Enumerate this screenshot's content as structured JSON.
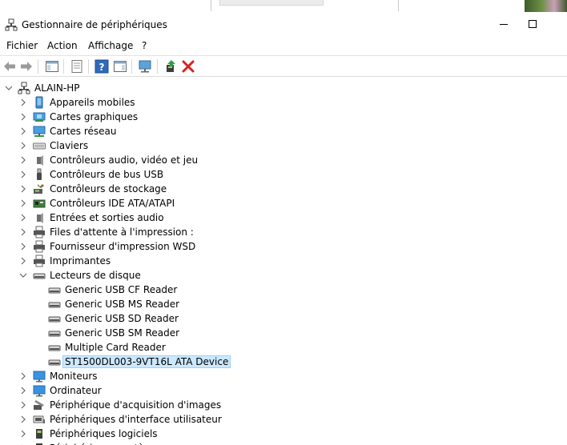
{
  "window": {
    "title": "Gestionnaire de périphériques"
  },
  "menu": {
    "items": [
      "Fichier",
      "Action",
      "Affichage",
      "?"
    ]
  },
  "tree": {
    "root": "ALAIN-HP",
    "categories": [
      {
        "label": "Appareils mobiles",
        "icon": "mobile-device-icon",
        "expanded": false
      },
      {
        "label": "Cartes graphiques",
        "icon": "display-adapter-icon",
        "expanded": false
      },
      {
        "label": "Cartes réseau",
        "icon": "network-adapter-icon",
        "expanded": false
      },
      {
        "label": "Claviers",
        "icon": "keyboard-icon",
        "expanded": false
      },
      {
        "label": "Contrôleurs audio, vidéo et jeu",
        "icon": "speaker-icon",
        "expanded": false
      },
      {
        "label": "Contrôleurs de bus USB",
        "icon": "usb-icon",
        "expanded": false
      },
      {
        "label": "Contrôleurs de stockage",
        "icon": "storage-controller-icon",
        "expanded": false
      },
      {
        "label": "Contrôleurs IDE ATA/ATAPI",
        "icon": "ide-controller-icon",
        "expanded": false
      },
      {
        "label": "Entrées et sorties audio",
        "icon": "speaker-icon",
        "expanded": false
      },
      {
        "label": "Files d'attente à l'impression :",
        "icon": "printer-icon",
        "expanded": false
      },
      {
        "label": "Fournisseur d'impression WSD",
        "icon": "printer-icon",
        "expanded": false
      },
      {
        "label": "Imprimantes",
        "icon": "printer-icon",
        "expanded": false
      },
      {
        "label": "Lecteurs de disque",
        "icon": "disk-drive-icon",
        "expanded": true,
        "children": [
          {
            "label": "Generic USB CF Reader",
            "selected": false
          },
          {
            "label": "Generic USB MS Reader",
            "selected": false
          },
          {
            "label": "Generic USB SD Reader",
            "selected": false
          },
          {
            "label": "Generic USB SM Reader",
            "selected": false
          },
          {
            "label": "Multiple Card Reader",
            "selected": false
          },
          {
            "label": "ST1500DL003-9VT16L ATA Device",
            "selected": true
          }
        ]
      },
      {
        "label": "Moniteurs",
        "icon": "monitor-icon",
        "expanded": false
      },
      {
        "label": "Ordinateur",
        "icon": "computer-icon",
        "expanded": false
      },
      {
        "label": "Périphérique d'acquisition d'images",
        "icon": "camera-icon",
        "expanded": false
      },
      {
        "label": "Périphériques d'interface utilisateur",
        "icon": "hid-icon",
        "expanded": false
      },
      {
        "label": "Périphériques logiciels",
        "icon": "software-device-icon",
        "expanded": false
      }
    ],
    "truncated_label": "Périphériques système"
  },
  "colors": {
    "selection": "#cce8ff",
    "selection_border": "#99d1ff",
    "remove_red": "#d9201f"
  }
}
